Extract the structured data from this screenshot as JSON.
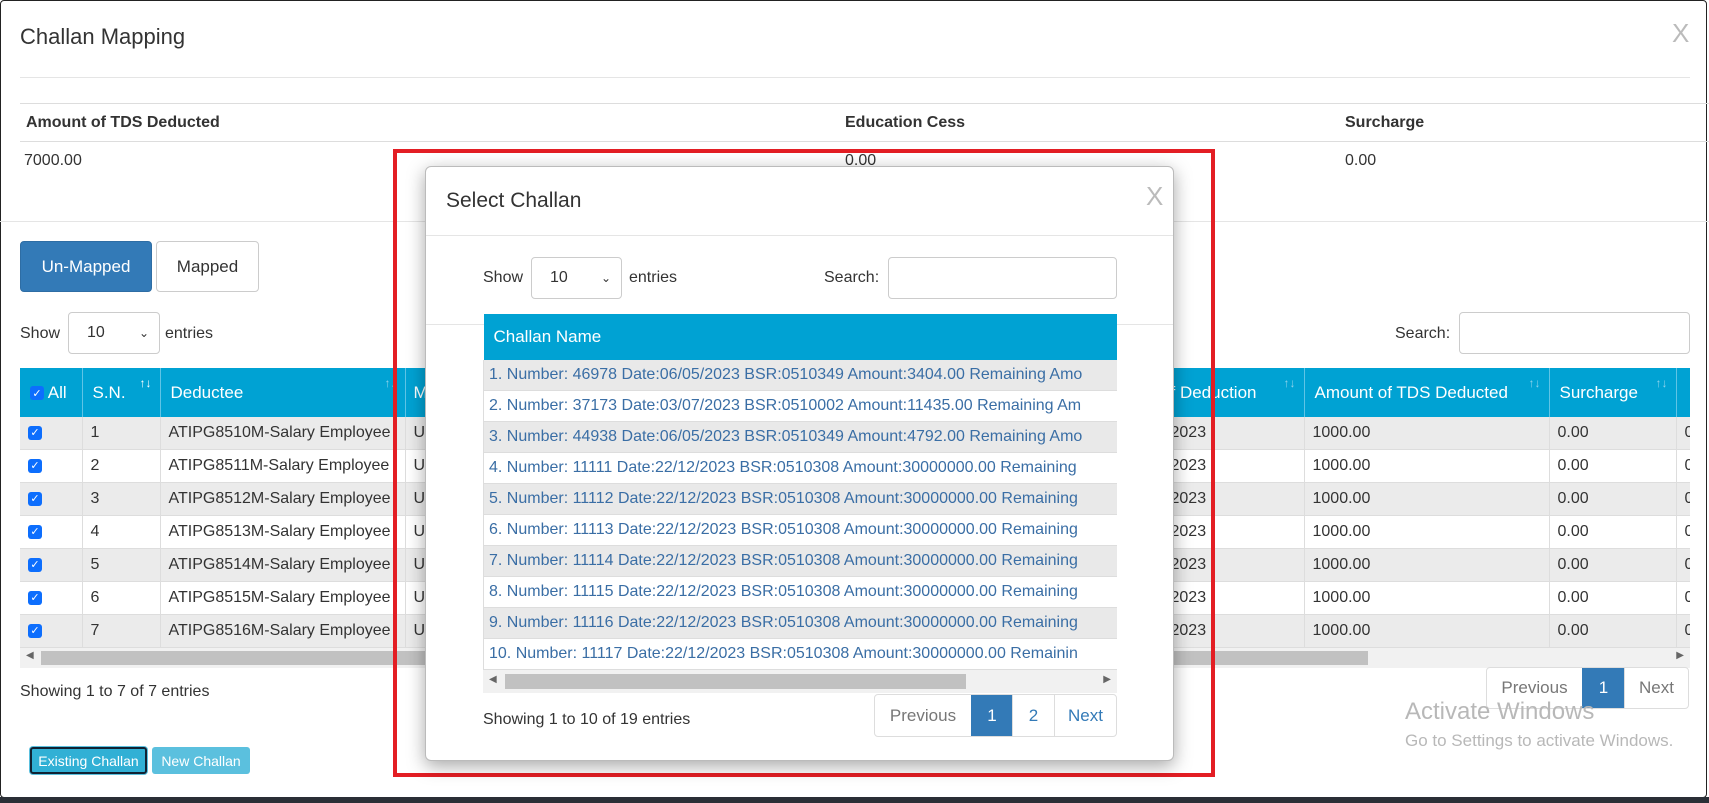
{
  "window": {
    "title": "Challan Mapping",
    "close_label": "X"
  },
  "summary": {
    "headers": [
      "Amount of TDS Deducted",
      "Education Cess",
      "Surcharge"
    ],
    "values": [
      "7000.00",
      "0.00",
      "0.00"
    ]
  },
  "tabs": {
    "unmapped": "Un-Mapped",
    "mapped": "Mapped"
  },
  "list_controls": {
    "show": "Show",
    "entries": "entries",
    "page_size": "10",
    "search_label": "Search:",
    "search_value": ""
  },
  "main_table": {
    "all_label": "All",
    "columns": [
      "S.N.",
      "Deductee",
      "M",
      "f Deduction",
      "Amount of TDS Deducted",
      "Surcharge",
      ""
    ],
    "rows": [
      {
        "checked": true,
        "sn": "1",
        "deductee": "ATIPG8510M-Salary Employee",
        "c3": "U",
        "c4": "2023",
        "amount": "1000.00",
        "surcharge": "0.00",
        "c7": "0"
      },
      {
        "checked": true,
        "sn": "2",
        "deductee": "ATIPG8511M-Salary Employee",
        "c3": "U",
        "c4": "2023",
        "amount": "1000.00",
        "surcharge": "0.00",
        "c7": "0"
      },
      {
        "checked": true,
        "sn": "3",
        "deductee": "ATIPG8512M-Salary Employee",
        "c3": "U",
        "c4": "2023",
        "amount": "1000.00",
        "surcharge": "0.00",
        "c7": "0"
      },
      {
        "checked": true,
        "sn": "4",
        "deductee": "ATIPG8513M-Salary Employee",
        "c3": "U",
        "c4": "2023",
        "amount": "1000.00",
        "surcharge": "0.00",
        "c7": "0"
      },
      {
        "checked": true,
        "sn": "5",
        "deductee": "ATIPG8514M-Salary Employee",
        "c3": "U",
        "c4": "2023",
        "amount": "1000.00",
        "surcharge": "0.00",
        "c7": "0"
      },
      {
        "checked": true,
        "sn": "6",
        "deductee": "ATIPG8515M-Salary Employee",
        "c3": "U",
        "c4": "2023",
        "amount": "1000.00",
        "surcharge": "0.00",
        "c7": "0"
      },
      {
        "checked": true,
        "sn": "7",
        "deductee": "ATIPG8516M-Salary Employee",
        "c3": "U",
        "c4": "2023",
        "amount": "1000.00",
        "surcharge": "0.00",
        "c7": "0"
      }
    ],
    "info": "Showing 1 to 7 of 7 entries",
    "pagination": {
      "previous": "Previous",
      "pages": [
        "1"
      ],
      "current": "1",
      "next": "Next"
    }
  },
  "actions": {
    "existing_challan": "Existing Challan",
    "new_challan": "New Challan"
  },
  "modal": {
    "title": "Select Challan",
    "close_label": "X",
    "show": "Show",
    "entries": "entries",
    "page_size": "10",
    "search_label": "Search:",
    "search_value": "",
    "column": "Challan Name",
    "rows": [
      "1. Number: 46978 Date:06/05/2023 BSR:0510349 Amount:3404.00 Remaining Amo",
      "2. Number: 37173 Date:03/07/2023 BSR:0510002 Amount:11435.00 Remaining Am",
      "3. Number: 44938 Date:06/05/2023 BSR:0510349 Amount:4792.00 Remaining Amo",
      "4. Number: 11111 Date:22/12/2023 BSR:0510308 Amount:30000000.00 Remaining",
      "5. Number: 11112 Date:22/12/2023 BSR:0510308 Amount:30000000.00 Remaining",
      "6. Number: 11113 Date:22/12/2023 BSR:0510308 Amount:30000000.00 Remaining",
      "7. Number: 11114 Date:22/12/2023 BSR:0510308 Amount:30000000.00 Remaining",
      "8. Number: 11115 Date:22/12/2023 BSR:0510308 Amount:30000000.00 Remaining",
      "9. Number: 11116 Date:22/12/2023 BSR:0510308 Amount:30000000.00 Remaining",
      "10. Number: 11117 Date:22/12/2023 BSR:0510308 Amount:30000000.00 Remainin"
    ],
    "info": "Showing 1 to 10 of 19 entries",
    "pagination": {
      "previous": "Previous",
      "pages": [
        "1",
        "2"
      ],
      "current": "1",
      "next": "Next"
    }
  },
  "watermark": {
    "line1": "Activate Windows",
    "line2": "Go to Settings to activate Windows."
  },
  "colors": {
    "header": "#00a2d3",
    "primary": "#337ab7",
    "info_button": "#5bc0de",
    "highlight_box": "#e31e24"
  }
}
